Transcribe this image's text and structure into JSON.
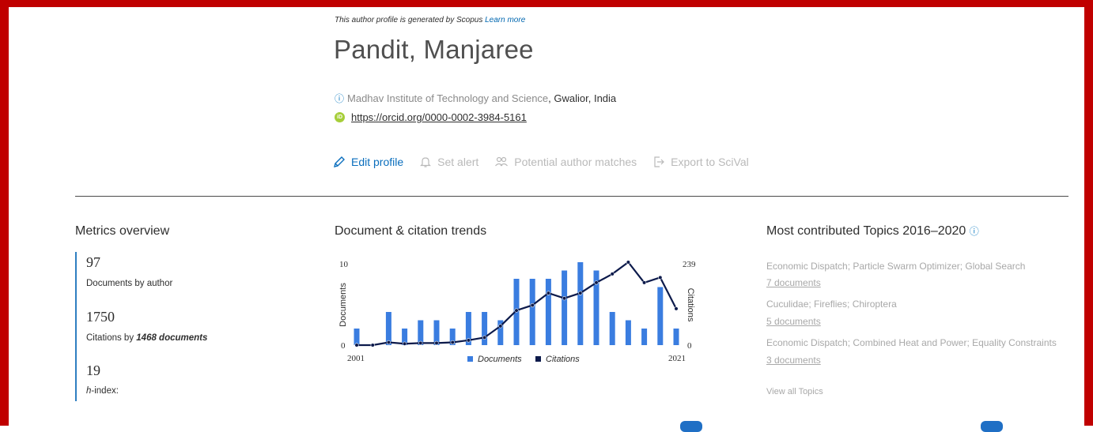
{
  "header": {
    "generated_text": "This author profile is generated by Scopus",
    "learn_more": "Learn more",
    "author_name": "Pandit, Manjaree",
    "affiliation_icon": "info-circle-icon",
    "institution": "Madhav Institute of Technology and Science",
    "location": ", Gwalior, India",
    "orcid_url": "https://orcid.org/0000-0002-3984-5161"
  },
  "actions": {
    "edit_profile": "Edit profile",
    "set_alert": "Set alert",
    "potential_matches": "Potential author matches",
    "export": "Export to SciVal"
  },
  "metrics": {
    "title": "Metrics overview",
    "documents": "97",
    "documents_label": "Documents by author",
    "citations": "1750",
    "citations_label_pre": "Citations by ",
    "citations_docs": "1468 documents",
    "hindex": "19",
    "hindex_label_h": "h",
    "hindex_label_rest": "-index:"
  },
  "trends": {
    "title": "Document & citation trends"
  },
  "topics": {
    "title": "Most contributed Topics 2016–2020",
    "items": [
      {
        "name": "Economic Dispatch; Particle Swarm Optimizer; Global Search",
        "docs": "7 documents"
      },
      {
        "name": "Cuculidae; Fireflies; Chiroptera",
        "docs": "5 documents"
      },
      {
        "name": "Economic Dispatch; Combined Heat and Power; Equality Constraints",
        "docs": "3 documents"
      }
    ],
    "view_all": "View all Topics"
  },
  "colors": {
    "frame": "#c00000",
    "bars": "#3a7de0",
    "citation_line": "#0c1a4b",
    "link": "#0a6ebd"
  },
  "chart_data": {
    "type": "bar",
    "x": [
      2001,
      2002,
      2003,
      2004,
      2005,
      2006,
      2007,
      2008,
      2009,
      2010,
      2011,
      2012,
      2013,
      2014,
      2015,
      2016,
      2017,
      2018,
      2019,
      2020,
      2021
    ],
    "series": [
      {
        "name": "Documents",
        "axis": "left",
        "values": [
          2,
          0,
          4,
          2,
          3,
          3,
          2,
          4,
          4,
          3,
          8,
          8,
          8,
          9,
          10,
          9,
          4,
          3,
          2,
          7,
          2
        ]
      },
      {
        "name": "Citations",
        "type": "line",
        "axis": "right",
        "values": [
          0,
          0,
          8,
          4,
          6,
          6,
          8,
          14,
          22,
          55,
          100,
          115,
          150,
          135,
          150,
          180,
          205,
          239,
          180,
          195,
          105
        ]
      }
    ],
    "ylabel": "Documents",
    "y2label": "Citations",
    "ylim": [
      0,
      10
    ],
    "y2lim": [
      0,
      239
    ],
    "x_ticks": [
      "2001",
      "2021"
    ],
    "y_ticks": [
      "0",
      "10"
    ],
    "y2_ticks": [
      "0",
      "239"
    ],
    "legend": "bottom"
  }
}
